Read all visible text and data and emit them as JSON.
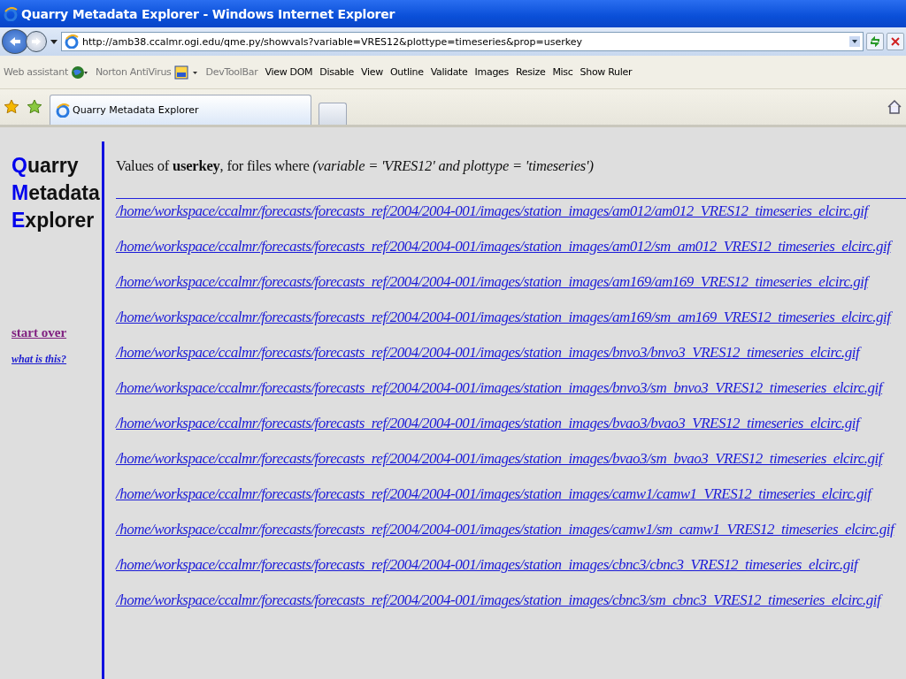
{
  "window": {
    "title": "Quarry Metadata Explorer - Windows Internet Explorer"
  },
  "address_bar": {
    "value": "http://amb38.ccalmr.ogi.edu/qme.py/showvals?variable=VRES12&plottype=timeseries&prop=userkey"
  },
  "toolbar": {
    "items": [
      {
        "label": "Web assistant",
        "kind": "globe"
      },
      {
        "label": "Norton AntiVirus",
        "kind": "norton"
      },
      {
        "label": "DevToolBar",
        "kind": "plain"
      },
      {
        "label": "View DOM",
        "kind": "plain"
      },
      {
        "label": "Disable",
        "kind": "plain"
      },
      {
        "label": "View",
        "kind": "plain"
      },
      {
        "label": "Outline",
        "kind": "plain"
      },
      {
        "label": "Validate",
        "kind": "plain"
      },
      {
        "label": "Images",
        "kind": "plain"
      },
      {
        "label": "Resize",
        "kind": "plain"
      },
      {
        "label": "Misc",
        "kind": "plain"
      },
      {
        "label": "Show Ruler",
        "kind": "plain"
      }
    ]
  },
  "tabs": [
    {
      "label": "Quarry Metadata Explorer",
      "selected": true
    }
  ],
  "sidebar": {
    "logo": [
      {
        "initial": "Q",
        "rest": "uarry"
      },
      {
        "initial": "M",
        "rest": "etadata"
      },
      {
        "initial": "E",
        "rest": "xplorer"
      }
    ],
    "links": [
      {
        "label": "start over",
        "kind": "visited"
      },
      {
        "label": "what is this?",
        "kind": "small"
      }
    ]
  },
  "heading": "Values of **userkey**, for files where *(variable = 'VRES12' and plottype = 'timeseries')*",
  "files": [
    "/home/workspace/ccalmr/forecasts/forecasts_ref/2004/2004-001/images/station_images/am012/am012_VRES12_timeseries_elcirc.gif",
    "/home/workspace/ccalmr/forecasts/forecasts_ref/2004/2004-001/images/station_images/am012/sm_am012_VRES12_timeseries_elcirc.gif",
    "/home/workspace/ccalmr/forecasts/forecasts_ref/2004/2004-001/images/station_images/am169/am169_VRES12_timeseries_elcirc.gif",
    "/home/workspace/ccalmr/forecasts/forecasts_ref/2004/2004-001/images/station_images/am169/sm_am169_VRES12_timeseries_elcirc.gif",
    "/home/workspace/ccalmr/forecasts/forecasts_ref/2004/2004-001/images/station_images/bnvo3/bnvo3_VRES12_timeseries_elcirc.gif",
    "/home/workspace/ccalmr/forecasts/forecasts_ref/2004/2004-001/images/station_images/bnvo3/sm_bnvo3_VRES12_timeseries_elcirc.gif",
    "/home/workspace/ccalmr/forecasts/forecasts_ref/2004/2004-001/images/station_images/bvao3/bvao3_VRES12_timeseries_elcirc.gif",
    "/home/workspace/ccalmr/forecasts/forecasts_ref/2004/2004-001/images/station_images/bvao3/sm_bvao3_VRES12_timeseries_elcirc.gif",
    "/home/workspace/ccalmr/forecasts/forecasts_ref/2004/2004-001/images/station_images/camw1/camw1_VRES12_timeseries_elcirc.gif",
    "/home/workspace/ccalmr/forecasts/forecasts_ref/2004/2004-001/images/station_images/camw1/sm_camw1_VRES12_timeseries_elcirc.gif",
    "/home/workspace/ccalmr/forecasts/forecasts_ref/2004/2004-001/images/station_images/cbnc3/cbnc3_VRES12_timeseries_elcirc.gif",
    "/home/workspace/ccalmr/forecasts/forecasts_ref/2004/2004-001/images/station_images/cbnc3/sm_cbnc3_VRES12_timeseries_elcirc.gif"
  ]
}
